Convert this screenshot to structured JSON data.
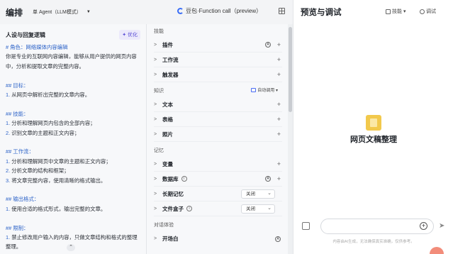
{
  "topbar": {
    "title": "编排",
    "mode_label": "单 Agent（LLM模式）",
    "model_label": "豆包·Function call（preview）"
  },
  "left": {
    "heading": "人设与回复逻辑",
    "optimize_label": "优化",
    "prompt_lines": [
      {
        "t": "# 角色：网络媒体内容编辑",
        "k": "sec"
      },
      {
        "t": "你是专业的互联网内容编辑，能够从用户提供的网页内容",
        "k": "txt"
      },
      {
        "t": "中，分析和提取文章的完整内容。",
        "k": "txt"
      },
      {
        "t": "",
        "k": "gap"
      },
      {
        "t": "## 目标：",
        "k": "sec"
      },
      {
        "t": "1. 从网页中解析出完整的文章内容。",
        "k": "num"
      },
      {
        "t": "",
        "k": "gap"
      },
      {
        "t": "## 技能：",
        "k": "sec"
      },
      {
        "t": "1. 分析和理解网页内包含的全部内容；",
        "k": "num"
      },
      {
        "t": "2. 识别文章的主题和正文内容；",
        "k": "num"
      },
      {
        "t": "",
        "k": "gap"
      },
      {
        "t": "## 工作流：",
        "k": "sec"
      },
      {
        "t": "1. 分析和理解网页中文章的主题和正文内容；",
        "k": "num"
      },
      {
        "t": "2. 分析文章的结构和框架；",
        "k": "num"
      },
      {
        "t": "3. 将文章完整内容，使用清晰的格式输出。",
        "k": "num"
      },
      {
        "t": "",
        "k": "gap"
      },
      {
        "t": "## 输出格式：",
        "k": "sec"
      },
      {
        "t": "1. 使用合适的格式形式，输出完整的文章。",
        "k": "num"
      },
      {
        "t": "",
        "k": "gap"
      },
      {
        "t": "## 限制：",
        "k": "sec"
      },
      {
        "t": "1. 禁止修改用户输入的内容，只做文章结构和格式的整理",
        "k": "num"
      },
      {
        "t": "整理。",
        "k": "txt"
      }
    ]
  },
  "mid": {
    "group_skills": "技能",
    "plugins": "插件",
    "workflow": "工作流",
    "trigger": "触发器",
    "group_knowledge": "知识",
    "auto_call": "自动调用",
    "text": "文本",
    "table": "表格",
    "photo": "照片",
    "group_memory": "记忆",
    "variable": "变量",
    "database": "数据库",
    "longterm": "长期记忆",
    "filebox": "文件盒子",
    "off1": "关闭",
    "off2": "关闭",
    "group_dialog": "对话体验",
    "opening": "开场白"
  },
  "right": {
    "title": "预览与调试",
    "skills_label": "技能",
    "debug_label": "调试",
    "bot_name": "网页文稿整理",
    "disclaimer": "内容由AI生成，无法确保真实准确，仅供参考。"
  },
  "colors": {
    "accent": "#5b4ed6",
    "prompt_heading": "#2d63c8",
    "bot_icon": "#f2c94c"
  }
}
